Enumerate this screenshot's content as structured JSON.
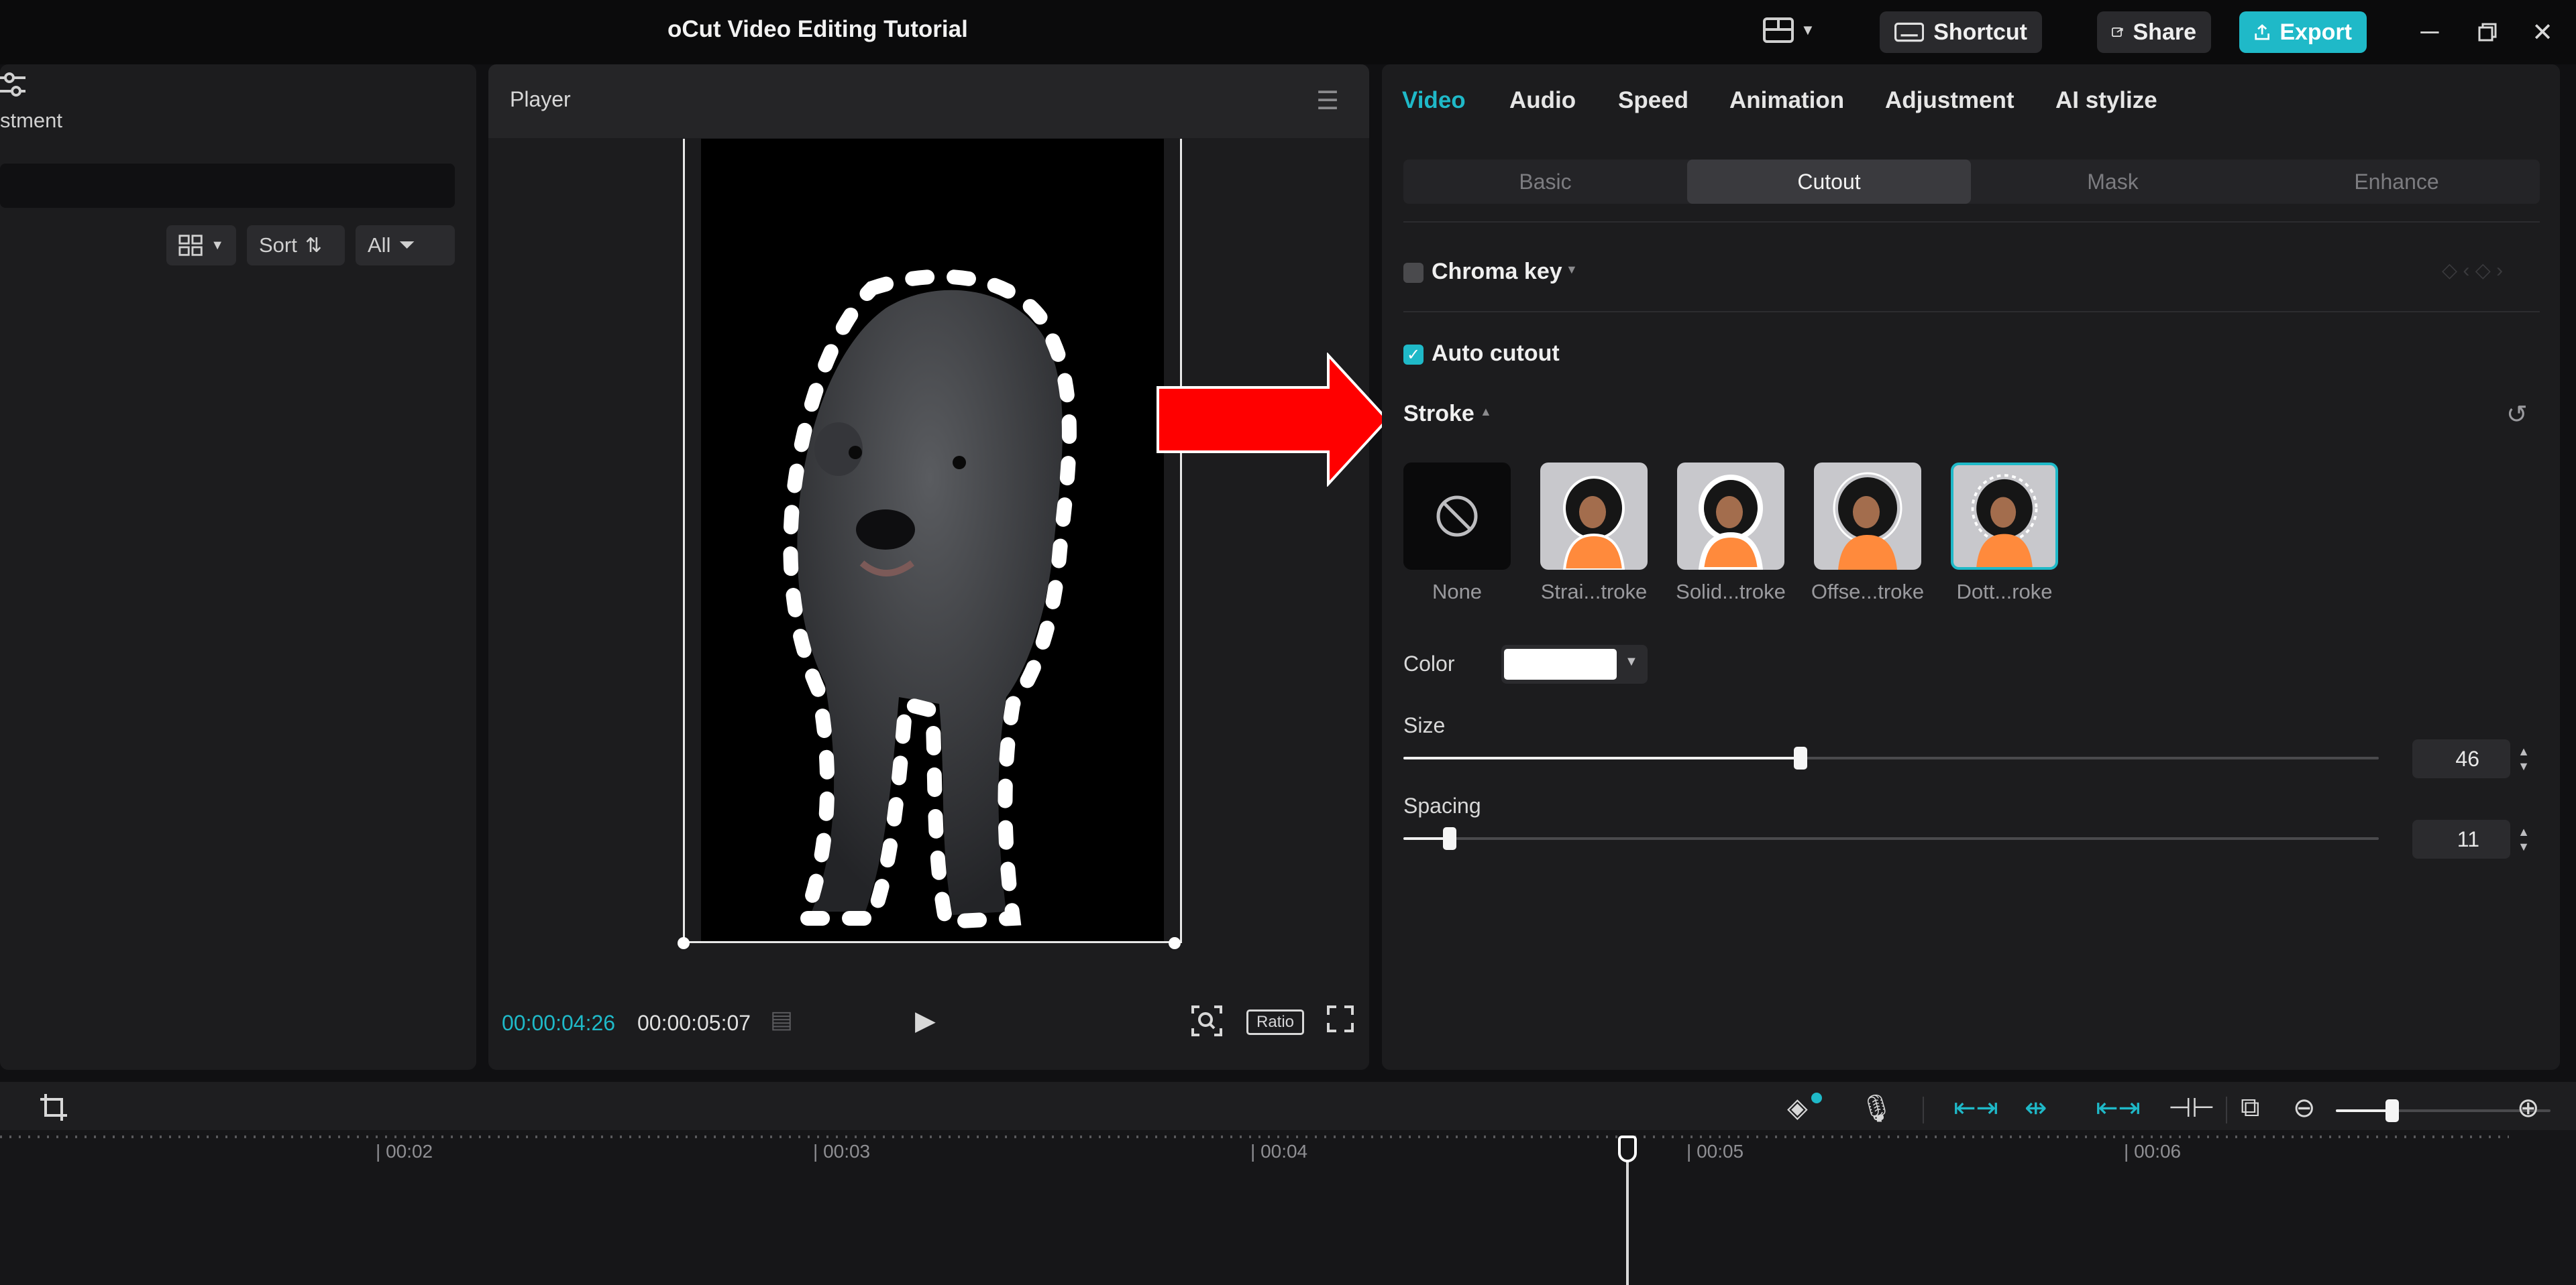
{
  "window": {
    "title": "oCut Video Editing Tutorial",
    "shortcut_label": "Shortcut",
    "share_label": "Share",
    "export_label": "Export"
  },
  "media": {
    "partial_label": "stment",
    "sort_label": "Sort",
    "filter_label": "All"
  },
  "player": {
    "title": "Player",
    "current_time": "00:00:04:26",
    "total_time": "00:00:05:07",
    "ratio_label": "Ratio"
  },
  "properties": {
    "tabs": [
      "Video",
      "Audio",
      "Speed",
      "Animation",
      "Adjustment",
      "AI stylize"
    ],
    "active_tab": "Video",
    "subtabs": [
      "Basic",
      "Cutout",
      "Mask",
      "Enhance"
    ],
    "active_subtab": "Cutout",
    "chroma_key": {
      "label": "Chroma key",
      "checked": false
    },
    "auto_cutout": {
      "label": "Auto cutout",
      "checked": true
    },
    "stroke": {
      "label": "Stroke",
      "presets": [
        "None",
        "Strai...troke",
        "Solid...troke",
        "Offse...troke",
        "Dott...roke"
      ],
      "selected": "Dott...roke"
    },
    "color": {
      "label": "Color",
      "value": "#ffffff"
    },
    "size": {
      "label": "Size",
      "value": "46",
      "fraction": 0.46
    },
    "spacing": {
      "label": "Spacing",
      "value": "11",
      "fraction": 0.11
    }
  },
  "timeline": {
    "ticks": [
      "00:02",
      "00:03",
      "00:04",
      "00:05",
      "00:06"
    ]
  },
  "colors": {
    "accent": "#1fb9c8",
    "annotation_arrow": "#ff0000"
  }
}
